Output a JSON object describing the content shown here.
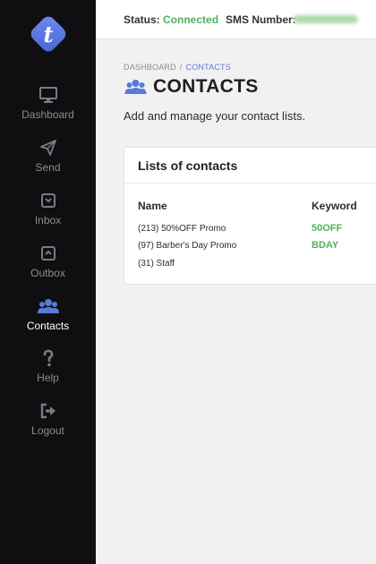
{
  "sidebar": {
    "logo_letter": "t",
    "items": [
      {
        "label": "Dashboard",
        "icon": "monitor-icon"
      },
      {
        "label": "Send",
        "icon": "paper-plane-icon"
      },
      {
        "label": "Inbox",
        "icon": "inbox-icon"
      },
      {
        "label": "Outbox",
        "icon": "outbox-icon"
      },
      {
        "label": "Contacts",
        "icon": "users-icon",
        "active": true
      },
      {
        "label": "Help",
        "icon": "question-icon"
      },
      {
        "label": "Logout",
        "icon": "sign-out-icon"
      }
    ],
    "active_color": "#5a7ad8"
  },
  "topbar": {
    "status_label": "Status:",
    "status_value": "Connected",
    "sms_label": "SMS Number:"
  },
  "breadcrumb": {
    "root": "DASHBOARD",
    "separator": "/",
    "current": "CONTACTS"
  },
  "page": {
    "title": "CONTACTS",
    "subtitle": "Add and manage your contact lists."
  },
  "contact_lists": {
    "title": "Lists of contacts",
    "columns": {
      "name": "Name",
      "keyword": "Keyword"
    },
    "rows": [
      {
        "name": "(213) 50%OFF Promo",
        "keyword": "50OFF"
      },
      {
        "name": "(97) Barber's Day Promo",
        "keyword": "BDAY"
      },
      {
        "name": "(31) Staff",
        "keyword": ""
      }
    ]
  },
  "colors": {
    "accent": "#5a7ad8",
    "success": "#4db35c",
    "sidebar_bg": "#0f0f11"
  }
}
